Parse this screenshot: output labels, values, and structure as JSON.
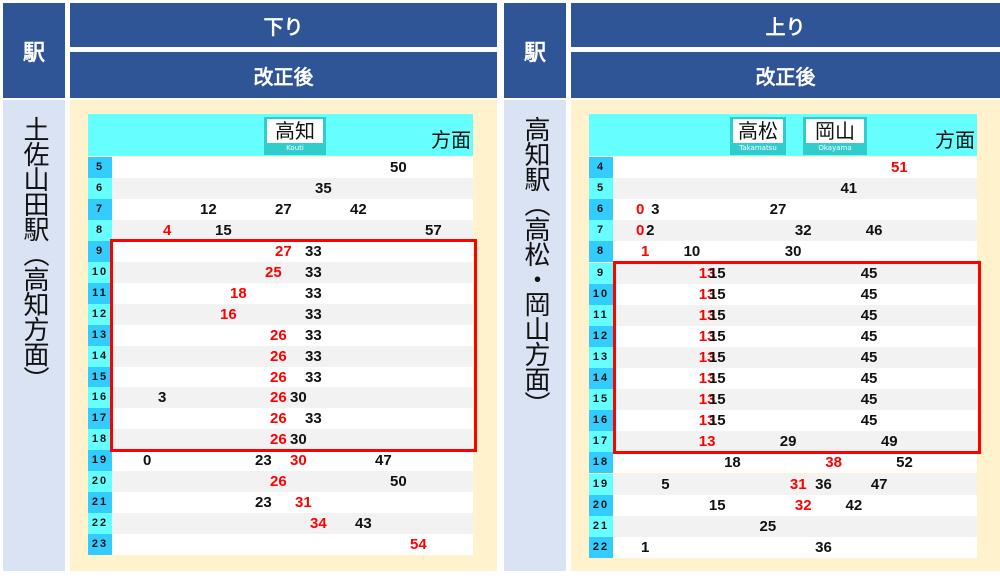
{
  "colors": {
    "header_bg": "#2f5597",
    "station_bg": "#dae3f3",
    "body_bg": "#fff2cc",
    "table_head_bg": "#66ffff",
    "dest_box_bg": "#33cccc",
    "hour_a": "#33ccff",
    "hour_b": "#66ffff",
    "row_a": "#ffffff",
    "row_b": "#f2f2f2",
    "highlight": "#ff0000",
    "red_minute": "#ff0000"
  },
  "panels": [
    {
      "station_header": "駅",
      "direction": "下り",
      "revision": "改正後",
      "station_name": "土佐山田駅（高知方面）",
      "destinations": [
        {
          "kanji": "高知",
          "romaji": "Kouti"
        }
      ],
      "hosen_label": "方面",
      "highlight_hours": [
        9,
        18
      ],
      "rows": [
        {
          "hour": "5",
          "minutes": [
            {
              "m": 50,
              "red": false
            }
          ]
        },
        {
          "hour": "6",
          "minutes": [
            {
              "m": 35,
              "red": false
            }
          ]
        },
        {
          "hour": "7",
          "minutes": [
            {
              "m": 12,
              "red": false
            },
            {
              "m": 27,
              "red": false
            },
            {
              "m": 42,
              "red": false
            }
          ]
        },
        {
          "hour": "8",
          "minutes": [
            {
              "m": 4,
              "red": true
            },
            {
              "m": 15,
              "red": false
            },
            {
              "m": 57,
              "red": false
            }
          ]
        },
        {
          "hour": "9",
          "minutes": [
            {
              "m": 27,
              "red": true
            },
            {
              "m": 33,
              "red": false
            }
          ]
        },
        {
          "hour": "10",
          "minutes": [
            {
              "m": 25,
              "red": true
            },
            {
              "m": 33,
              "red": false
            }
          ]
        },
        {
          "hour": "11",
          "minutes": [
            {
              "m": 18,
              "red": true
            },
            {
              "m": 33,
              "red": false
            }
          ]
        },
        {
          "hour": "12",
          "minutes": [
            {
              "m": 16,
              "red": true
            },
            {
              "m": 33,
              "red": false
            }
          ]
        },
        {
          "hour": "13",
          "minutes": [
            {
              "m": 26,
              "red": true
            },
            {
              "m": 33,
              "red": false
            }
          ]
        },
        {
          "hour": "14",
          "minutes": [
            {
              "m": 26,
              "red": true
            },
            {
              "m": 33,
              "red": false
            }
          ]
        },
        {
          "hour": "15",
          "minutes": [
            {
              "m": 26,
              "red": true
            },
            {
              "m": 33,
              "red": false
            }
          ]
        },
        {
          "hour": "16",
          "minutes": [
            {
              "m": 3,
              "red": false
            },
            {
              "m": 26,
              "red": true
            },
            {
              "m": 30,
              "red": false
            }
          ]
        },
        {
          "hour": "17",
          "minutes": [
            {
              "m": 26,
              "red": true
            },
            {
              "m": 33,
              "red": false
            }
          ]
        },
        {
          "hour": "18",
          "minutes": [
            {
              "m": 26,
              "red": true
            },
            {
              "m": 30,
              "red": false
            }
          ]
        },
        {
          "hour": "19",
          "minutes": [
            {
              "m": 0,
              "red": false
            },
            {
              "m": 23,
              "red": false
            },
            {
              "m": 30,
              "red": true
            },
            {
              "m": 47,
              "red": false
            }
          ]
        },
        {
          "hour": "20",
          "minutes": [
            {
              "m": 26,
              "red": true
            },
            {
              "m": 50,
              "red": false
            }
          ]
        },
        {
          "hour": "21",
          "minutes": [
            {
              "m": 23,
              "red": false
            },
            {
              "m": 31,
              "red": true
            }
          ]
        },
        {
          "hour": "22",
          "minutes": [
            {
              "m": 34,
              "red": true
            },
            {
              "m": 43,
              "red": false
            }
          ]
        },
        {
          "hour": "23",
          "minutes": [
            {
              "m": 54,
              "red": true
            }
          ]
        }
      ]
    },
    {
      "station_header": "駅",
      "direction": "上り",
      "revision": "改正後",
      "station_name": "高知駅（高松・岡山方面）",
      "destinations": [
        {
          "kanji": "高松",
          "romaji": "Takamatsu"
        },
        {
          "kanji": "岡山",
          "romaji": "Okayama"
        }
      ],
      "hosen_label": "方面",
      "highlight_hours": [
        9,
        17
      ],
      "rows": [
        {
          "hour": "4",
          "minutes": [
            {
              "m": 51,
              "red": true
            }
          ]
        },
        {
          "hour": "5",
          "minutes": [
            {
              "m": 41,
              "red": false
            }
          ]
        },
        {
          "hour": "6",
          "minutes": [
            {
              "m": 0,
              "red": true
            },
            {
              "m": 3,
              "red": false
            },
            {
              "m": 27,
              "red": false
            }
          ]
        },
        {
          "hour": "7",
          "minutes": [
            {
              "m": 0,
              "red": true
            },
            {
              "m": 2,
              "red": false
            },
            {
              "m": 32,
              "red": false
            },
            {
              "m": 46,
              "red": false
            }
          ]
        },
        {
          "hour": "8",
          "minutes": [
            {
              "m": 1,
              "red": true
            },
            {
              "m": 10,
              "red": false
            },
            {
              "m": 30,
              "red": false
            }
          ]
        },
        {
          "hour": "9",
          "minutes": [
            {
              "m": 13,
              "red": true
            },
            {
              "m": 15,
              "red": false
            },
            {
              "m": 45,
              "red": false
            }
          ]
        },
        {
          "hour": "10",
          "minutes": [
            {
              "m": 13,
              "red": true
            },
            {
              "m": 15,
              "red": false
            },
            {
              "m": 45,
              "red": false
            }
          ]
        },
        {
          "hour": "11",
          "minutes": [
            {
              "m": 13,
              "red": true
            },
            {
              "m": 15,
              "red": false
            },
            {
              "m": 45,
              "red": false
            }
          ]
        },
        {
          "hour": "12",
          "minutes": [
            {
              "m": 13,
              "red": true
            },
            {
              "m": 15,
              "red": false
            },
            {
              "m": 45,
              "red": false
            }
          ]
        },
        {
          "hour": "13",
          "minutes": [
            {
              "m": 13,
              "red": true
            },
            {
              "m": 15,
              "red": false
            },
            {
              "m": 45,
              "red": false
            }
          ]
        },
        {
          "hour": "14",
          "minutes": [
            {
              "m": 13,
              "red": true
            },
            {
              "m": 15,
              "red": false
            },
            {
              "m": 45,
              "red": false
            }
          ]
        },
        {
          "hour": "15",
          "minutes": [
            {
              "m": 13,
              "red": true
            },
            {
              "m": 15,
              "red": false
            },
            {
              "m": 45,
              "red": false
            }
          ]
        },
        {
          "hour": "16",
          "minutes": [
            {
              "m": 13,
              "red": true
            },
            {
              "m": 15,
              "red": false
            },
            {
              "m": 45,
              "red": false
            }
          ]
        },
        {
          "hour": "17",
          "minutes": [
            {
              "m": 13,
              "red": true
            },
            {
              "m": 29,
              "red": false
            },
            {
              "m": 49,
              "red": false
            }
          ]
        },
        {
          "hour": "18",
          "minutes": [
            {
              "m": 18,
              "red": false
            },
            {
              "m": 38,
              "red": true
            },
            {
              "m": 52,
              "red": false
            }
          ]
        },
        {
          "hour": "19",
          "minutes": [
            {
              "m": 5,
              "red": false
            },
            {
              "m": 31,
              "red": true
            },
            {
              "m": 36,
              "red": false
            },
            {
              "m": 47,
              "red": false
            }
          ]
        },
        {
          "hour": "20",
          "minutes": [
            {
              "m": 15,
              "red": false
            },
            {
              "m": 32,
              "red": true
            },
            {
              "m": 42,
              "red": false
            }
          ]
        },
        {
          "hour": "21",
          "minutes": [
            {
              "m": 25,
              "red": false
            }
          ]
        },
        {
          "hour": "22",
          "minutes": [
            {
              "m": 1,
              "red": false
            },
            {
              "m": 36,
              "red": false
            }
          ]
        }
      ]
    }
  ]
}
